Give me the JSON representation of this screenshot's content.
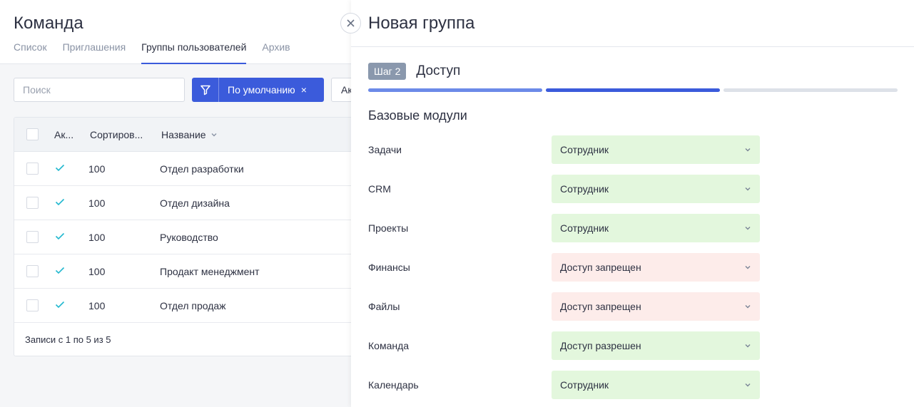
{
  "page": {
    "title": "Команда",
    "tabs": [
      {
        "label": "Список"
      },
      {
        "label": "Приглашения"
      },
      {
        "label": "Группы пользователей"
      },
      {
        "label": "Архив"
      }
    ]
  },
  "toolbar": {
    "search_placeholder": "Поиск",
    "filter_label": "По умолчанию",
    "filter_clear": "×",
    "extra_label": "Ак"
  },
  "table": {
    "headers": {
      "active": "Ак...",
      "sort": "Сортиров...",
      "name": "Название"
    },
    "rows": [
      {
        "sort": "100",
        "name": "Отдел разработки"
      },
      {
        "sort": "100",
        "name": "Отдел дизайна"
      },
      {
        "sort": "100",
        "name": "Руководство"
      },
      {
        "sort": "100",
        "name": "Продакт менеджмент"
      },
      {
        "sort": "100",
        "name": "Отдел продаж"
      }
    ],
    "footer": "Записи с 1 по 5 из 5"
  },
  "panel": {
    "title": "Новая группа",
    "step_badge": "Шаг 2",
    "step_name": "Доступ",
    "steps_total": 3,
    "current_step": 2,
    "section_title": "Базовые модули",
    "modules": [
      {
        "label": "Задачи",
        "value": "Сотрудник",
        "status": "allow"
      },
      {
        "label": "CRM",
        "value": "Сотрудник",
        "status": "allow"
      },
      {
        "label": "Проекты",
        "value": "Сотрудник",
        "status": "allow"
      },
      {
        "label": "Финансы",
        "value": "Доступ запрещен",
        "status": "deny"
      },
      {
        "label": "Файлы",
        "value": "Доступ запрещен",
        "status": "deny"
      },
      {
        "label": "Команда",
        "value": "Доступ разрешен",
        "status": "allow"
      },
      {
        "label": "Календарь",
        "value": "Сотрудник",
        "status": "allow"
      }
    ]
  },
  "colors": {
    "accent": "#3b5bdb",
    "allow_bg": "#e3f7dd",
    "deny_bg": "#fdecea",
    "check": "#22b8cf"
  }
}
